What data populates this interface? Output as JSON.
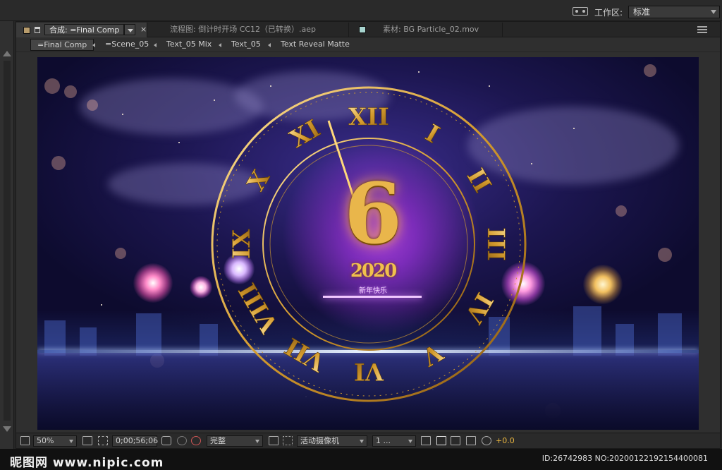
{
  "workspace": {
    "label": "工作区:",
    "value": "标准"
  },
  "tabs": {
    "composition": {
      "prefix": "合成:",
      "name": "=Final Comp",
      "close": "×"
    },
    "flowchart": {
      "label": "流程图: 倒计时开场 CC12（已转换）.aep"
    },
    "footage": {
      "label": "素材: BG Particle_02.mov"
    }
  },
  "breadcrumbs": [
    {
      "label": "=Final Comp"
    },
    {
      "label": "=Scene_05"
    },
    {
      "label": "Text_05 Mix"
    },
    {
      "label": "Text_05"
    },
    {
      "label": "Text Reveal Matte"
    }
  ],
  "preview": {
    "countdown_digit": "6",
    "year_text": "2020",
    "greeting": "新年快乐",
    "roman_numerals": [
      "XII",
      "I",
      "II",
      "III",
      "IV",
      "V",
      "VI",
      "VII",
      "VIII",
      "IX",
      "X",
      "XI"
    ]
  },
  "viewer_toolbar": {
    "zoom": "50%",
    "timecode": "0;00;56;06",
    "resolution": "完整",
    "camera": "活动摄像机",
    "views": "1 ...",
    "exposure": "+0.0"
  },
  "colors": {
    "accent_gold": "#e9b64b",
    "exposure_text": "#e9b640",
    "comp_swatch": "#b89c6c",
    "footage_swatch": "#a7d4cf"
  },
  "watermark": {
    "logo": "昵图网 www.nipic.com",
    "id_text": "ID:26742983 NO:20200122192154400081"
  }
}
